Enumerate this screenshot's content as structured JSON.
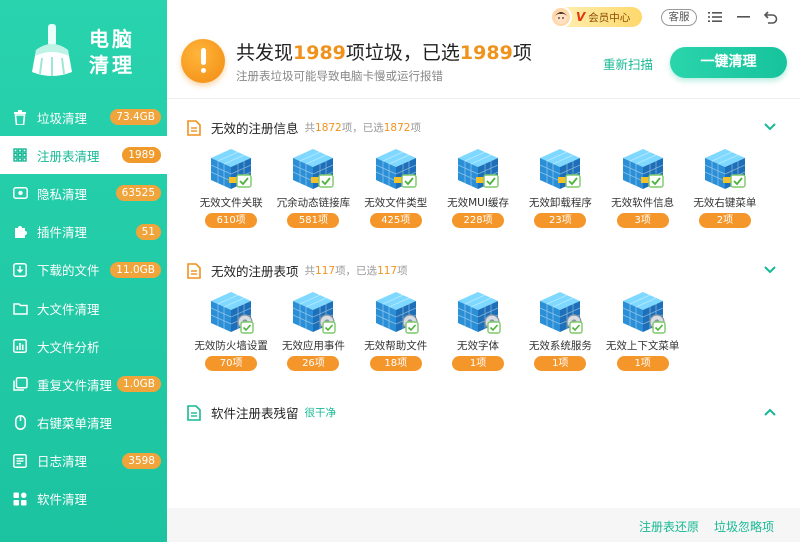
{
  "app": {
    "title_line1": "电脑",
    "title_line2": "清理"
  },
  "sidebar": {
    "items": [
      {
        "label": "垃圾清理",
        "badge": "73.4GB",
        "icon": "trash-icon"
      },
      {
        "label": "注册表清理",
        "badge": "1989",
        "icon": "grid-icon",
        "active": true
      },
      {
        "label": "隐私清理",
        "badge": "63525",
        "icon": "eye-icon"
      },
      {
        "label": "插件清理",
        "badge": "51",
        "icon": "puzzle-icon"
      },
      {
        "label": "下载的文件",
        "badge": "11.0GB",
        "icon": "download-icon"
      },
      {
        "label": "大文件清理",
        "badge": "",
        "icon": "folder-icon"
      },
      {
        "label": "大文件分析",
        "badge": "",
        "icon": "chart-icon"
      },
      {
        "label": "重复文件清理",
        "badge": "1.0GB",
        "icon": "copy-icon"
      },
      {
        "label": "右键菜单清理",
        "badge": "",
        "icon": "mouse-icon"
      },
      {
        "label": "日志清理",
        "badge": "3598",
        "icon": "log-icon"
      },
      {
        "label": "软件清理",
        "badge": "",
        "icon": "apps-icon"
      }
    ]
  },
  "topbar": {
    "vip_label": "会员中心",
    "vip_v": "V",
    "service_label": "客服"
  },
  "header": {
    "t1": "共发现",
    "found": "1989",
    "t2": "项垃圾，已选",
    "selected": "1989",
    "t3": "项",
    "subtitle": "注册表垃圾可能导致电脑卡慢或运行报错",
    "rescan_label": "重新扫描",
    "clean_label": "一键清理"
  },
  "sections": [
    {
      "title": "无效的注册信息",
      "meta_prefix": "共",
      "total": "1872",
      "meta_mid": "项，已选",
      "selected": "1872",
      "meta_suffix": "项",
      "items": [
        {
          "label": "无效文件关联",
          "count": "610项"
        },
        {
          "label": "冗余动态链接库",
          "count": "581项"
        },
        {
          "label": "无效文件类型",
          "count": "425项"
        },
        {
          "label": "无效MUI缓存",
          "count": "228项"
        },
        {
          "label": "无效卸载程序",
          "count": "23项"
        },
        {
          "label": "无效软件信息",
          "count": "3项"
        },
        {
          "label": "无效右键菜单",
          "count": "2项"
        }
      ]
    },
    {
      "title": "无效的注册表项",
      "meta_prefix": "共",
      "total": "117",
      "meta_mid": "项，已选",
      "selected": "117",
      "meta_suffix": "项",
      "items": [
        {
          "label": "无效防火墙设置",
          "count": "70项"
        },
        {
          "label": "无效应用事件",
          "count": "26项"
        },
        {
          "label": "无效帮助文件",
          "count": "18项"
        },
        {
          "label": "无效字体",
          "count": "1项"
        },
        {
          "label": "无效系统服务",
          "count": "1项"
        },
        {
          "label": "无效上下文菜单",
          "count": "1项"
        }
      ]
    },
    {
      "title": "软件注册表残留",
      "status": "很干净"
    }
  ],
  "footer": {
    "restore_label": "注册表还原",
    "ignore_label": "垃圾忽略项"
  },
  "colors": {
    "accent": "#1cc3a0",
    "orange": "#f0921c"
  }
}
